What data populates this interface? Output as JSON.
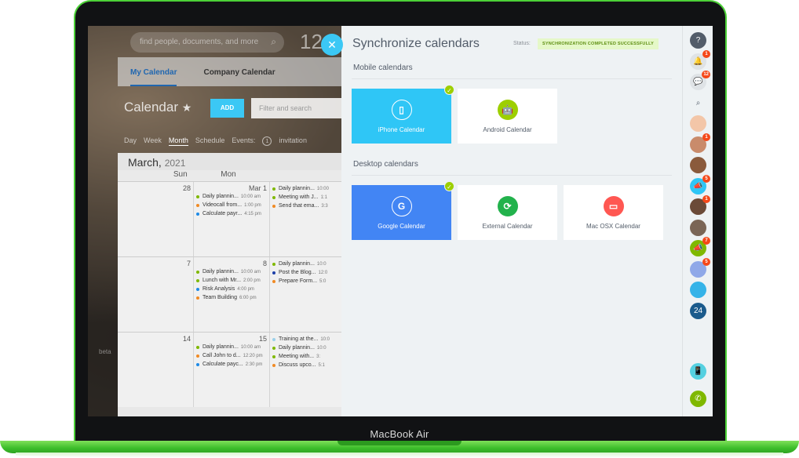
{
  "device": {
    "label": "MacBook Air"
  },
  "background_app": {
    "search_placeholder": "find people, documents, and more",
    "clock": "12",
    "tabs": [
      "My Calendar",
      "Company Calendar"
    ],
    "title": "Calendar",
    "add_label": "ADD",
    "filter_placeholder": "Filter and search",
    "views": [
      "Day",
      "Week",
      "Month",
      "Schedule"
    ],
    "events_label": "Events:",
    "events_count": "1",
    "invitation_label": "invitation",
    "month_title": "March,",
    "year": "2021",
    "day_headers": [
      "Sun",
      "Mon",
      ""
    ],
    "weeks": [
      {
        "days": [
          {
            "num": "28",
            "events": []
          },
          {
            "num": "Mar 1",
            "events": [
              {
                "name": "Daily plannin...",
                "time": "10:00 am",
                "color": "#7fb800"
              },
              {
                "name": "Videocall from...",
                "time": "1:00 pm",
                "color": "#f08a24"
              },
              {
                "name": "Calculate payr...",
                "time": "4:15 pm",
                "color": "#1e8ae6"
              }
            ]
          },
          {
            "num": "",
            "events": [
              {
                "name": "Daily plannin...",
                "time": "10:00",
                "color": "#7fb800"
              },
              {
                "name": "Meeting with J...",
                "time": "1:1",
                "color": "#7fb800"
              },
              {
                "name": "Send that ema...",
                "time": "3:3",
                "color": "#f08a24"
              }
            ]
          }
        ]
      },
      {
        "days": [
          {
            "num": "7",
            "events": []
          },
          {
            "num": "8",
            "events": [
              {
                "name": "Daily plannin...",
                "time": "10:00 am",
                "color": "#7fb800"
              },
              {
                "name": "Lunch with Mr...",
                "time": "2:00 pm",
                "color": "#7fb800"
              },
              {
                "name": "Risk Analysis",
                "time": "4:00 pm",
                "color": "#1e8ae6"
              },
              {
                "name": "Team Building",
                "time": "6:00 pm",
                "color": "#f08a24"
              }
            ]
          },
          {
            "num": "",
            "events": [
              {
                "name": "Daily plannin...",
                "time": "10:0",
                "color": "#7fb800"
              },
              {
                "name": "Post the Blog...",
                "time": "12:0",
                "color": "#1c3fa8"
              },
              {
                "name": "Prepare Form...",
                "time": "5:0",
                "color": "#f08a24"
              }
            ]
          }
        ]
      },
      {
        "days": [
          {
            "num": "14",
            "events": []
          },
          {
            "num": "15",
            "events": [
              {
                "name": "Daily plannin...",
                "time": "10:00 am",
                "color": "#7fb800"
              },
              {
                "name": "Call John to d...",
                "time": "12:20 pm",
                "color": "#f08a24"
              },
              {
                "name": "Calculate payc...",
                "time": "2:30 pm",
                "color": "#1e8ae6"
              }
            ]
          },
          {
            "num": "",
            "events": [
              {
                "name": "Training at the...",
                "time": "10:0",
                "color": "#9ad0ea"
              },
              {
                "name": "Daily plannin...",
                "time": "10:0",
                "color": "#7fb800"
              },
              {
                "name": "Meeting with...",
                "time": "3:",
                "color": "#7fb800"
              },
              {
                "name": "Discuss upco...",
                "time": "5:1",
                "color": "#f08a24"
              }
            ]
          }
        ]
      }
    ],
    "beta_label": "beta"
  },
  "panel": {
    "title": "Synchronize calendars",
    "status_label": "Status:",
    "status_value": "SYNCHRONIZATION COMPLETED SUCCESSFULLY",
    "mobile_section": "Mobile calendars",
    "desktop_section": "Desktop calendars",
    "mobile": [
      {
        "label": "iPhone Calendar",
        "icon": "phone-icon",
        "selected": true,
        "bg": "#2fc6f6",
        "icon_color": "#2fc6f6"
      },
      {
        "label": "Android Calendar",
        "icon": "android-icon",
        "selected": false,
        "bg": "#ffffff",
        "icon_color": "#9dcf00"
      }
    ],
    "desktop": [
      {
        "label": "Google Calendar",
        "icon": "google-icon",
        "selected": true,
        "bg": "#4285f4",
        "icon_color": "#4285f4"
      },
      {
        "label": "External Calendar",
        "icon": "sync-calendar-icon",
        "selected": false,
        "bg": "#ffffff",
        "icon_color": "#22b24c"
      },
      {
        "label": "Mac OSX Calendar",
        "icon": "monitor-icon",
        "selected": false,
        "bg": "#ffffff",
        "icon_color": "#ff5752"
      }
    ]
  },
  "rail": {
    "items": [
      {
        "name": "help-icon",
        "glyph": "?",
        "badge": "",
        "color": "#525c69"
      },
      {
        "name": "bell-icon",
        "glyph": "🔔",
        "badge": "1",
        "color": "#dfe3e6"
      },
      {
        "name": "chat-icon",
        "glyph": "💬",
        "badge": "12",
        "color": "#dfe3e6"
      },
      {
        "name": "search-icon",
        "glyph": "⌕",
        "badge": "",
        "color": "transparent"
      },
      {
        "name": "avatar-1",
        "glyph": "",
        "badge": "",
        "color": "#f3c6a8"
      },
      {
        "name": "avatar-2",
        "glyph": "",
        "badge": "1",
        "color": "#c98b6b"
      },
      {
        "name": "avatar-3",
        "glyph": "",
        "badge": "",
        "color": "#8a5a3c"
      },
      {
        "name": "megaphone-icon",
        "glyph": "📣",
        "badge": "5",
        "color": "#2fc6f6"
      },
      {
        "name": "avatar-4",
        "glyph": "",
        "badge": "1",
        "color": "#6b4a38"
      },
      {
        "name": "avatar-5",
        "glyph": "",
        "badge": "",
        "color": "#7a6556"
      },
      {
        "name": "megaphone-green-icon",
        "glyph": "📣",
        "badge": "7",
        "color": "#7fb800"
      },
      {
        "name": "avatar-6",
        "glyph": "",
        "badge": "5",
        "color": "#8fa8e8"
      },
      {
        "name": "avatar-7",
        "glyph": "",
        "badge": "",
        "color": "#35b3e8"
      },
      {
        "name": "bitrix24-icon",
        "glyph": "24",
        "badge": "",
        "color": "#1b5b8c"
      }
    ],
    "bottom": [
      {
        "name": "sync-phone-icon",
        "glyph": "📱",
        "color": "#55d0e0"
      },
      {
        "name": "call-icon",
        "glyph": "✆",
        "color": "#7fb800"
      }
    ]
  }
}
